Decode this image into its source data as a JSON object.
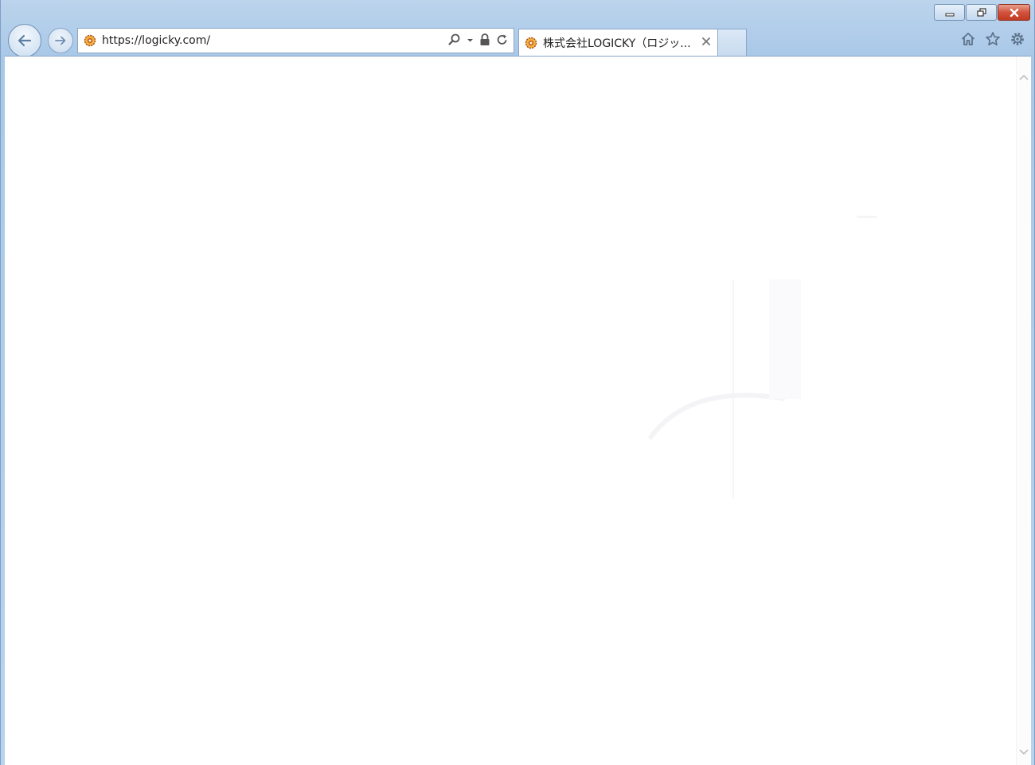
{
  "window": {
    "caption_buttons": {
      "minimize": "minimize-icon",
      "restore": "restore-icon",
      "close": "close-icon"
    }
  },
  "navigation": {
    "back_icon": "arrow-left-icon",
    "forward_icon": "arrow-right-icon"
  },
  "address_bar": {
    "url": "https://logicky.com/",
    "favicon": "gear-favicon-icon",
    "tools": [
      "search-icon",
      "dropdown-icon",
      "lock-icon",
      "refresh-icon"
    ]
  },
  "tabs": [
    {
      "title": "株式会社LOGICKY（ロジッ...",
      "favicon": "gear-favicon-icon",
      "close_icon": "close-icon",
      "active": true
    }
  ],
  "toolbar": {
    "icons": [
      "home-icon",
      "star-icon",
      "gear-icon"
    ]
  },
  "colors": {
    "frame": "#a9c8e8",
    "close_button": "#c23a22",
    "favicon": "#c8641e"
  }
}
